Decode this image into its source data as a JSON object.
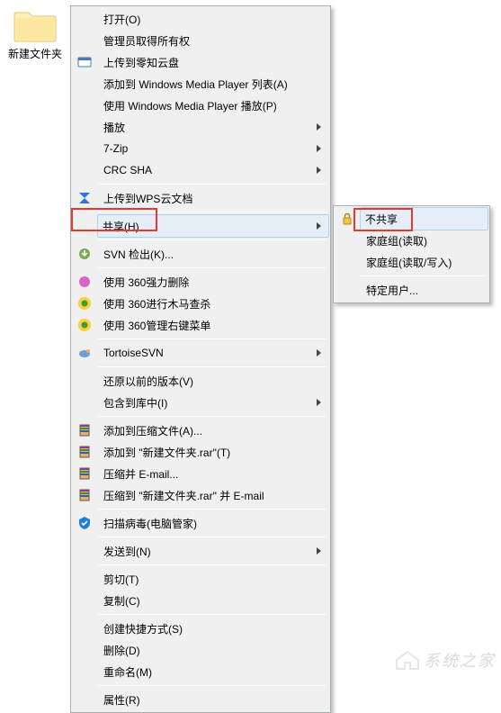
{
  "folder": {
    "label": "新建文件夹"
  },
  "main_menu": {
    "groups": [
      [
        {
          "label": "打开(O)",
          "icon": null,
          "sub": false
        },
        {
          "label": "管理员取得所有权",
          "icon": null,
          "sub": false
        },
        {
          "label": "上传到零知云盘",
          "icon": "cloud",
          "sub": false
        },
        {
          "label": "添加到 Windows Media Player 列表(A)",
          "icon": null,
          "sub": false
        },
        {
          "label": "使用 Windows Media Player 播放(P)",
          "icon": null,
          "sub": false
        },
        {
          "label": "播放",
          "icon": null,
          "sub": true
        },
        {
          "label": "7-Zip",
          "icon": null,
          "sub": true
        },
        {
          "label": "CRC SHA",
          "icon": null,
          "sub": true
        }
      ],
      [
        {
          "label": "上传到WPS云文档",
          "icon": "wps",
          "sub": false
        }
      ],
      [
        {
          "label": "共享(H)",
          "icon": null,
          "sub": true,
          "highlight": true
        }
      ],
      [
        {
          "label": "SVN 检出(K)...",
          "icon": "svn-checkout",
          "sub": false
        }
      ],
      [
        {
          "label": "使用 360强力删除",
          "icon": "360-del",
          "sub": false
        },
        {
          "label": "使用 360进行木马查杀",
          "icon": "360-scan",
          "sub": false
        },
        {
          "label": "使用 360管理右键菜单",
          "icon": "360-menu",
          "sub": false
        }
      ],
      [
        {
          "label": "TortoiseSVN",
          "icon": "tortoise",
          "sub": true
        }
      ],
      [
        {
          "label": "还原以前的版本(V)",
          "icon": null,
          "sub": false
        },
        {
          "label": "包含到库中(I)",
          "icon": null,
          "sub": true
        }
      ],
      [
        {
          "label": "添加到压缩文件(A)...",
          "icon": "rar",
          "sub": false
        },
        {
          "label": "添加到 \"新建文件夹.rar\"(T)",
          "icon": "rar",
          "sub": false
        },
        {
          "label": "压缩并 E-mail...",
          "icon": "rar",
          "sub": false
        },
        {
          "label": "压缩到 \"新建文件夹.rar\" 并 E-mail",
          "icon": "rar",
          "sub": false
        }
      ],
      [
        {
          "label": "扫描病毒(电脑管家)",
          "icon": "guanjia",
          "sub": false
        }
      ],
      [
        {
          "label": "发送到(N)",
          "icon": null,
          "sub": true
        }
      ],
      [
        {
          "label": "剪切(T)",
          "icon": null,
          "sub": false
        },
        {
          "label": "复制(C)",
          "icon": null,
          "sub": false
        }
      ],
      [
        {
          "label": "创建快捷方式(S)",
          "icon": null,
          "sub": false
        },
        {
          "label": "删除(D)",
          "icon": null,
          "sub": false
        },
        {
          "label": "重命名(M)",
          "icon": null,
          "sub": false
        }
      ],
      [
        {
          "label": "属性(R)",
          "icon": null,
          "sub": false
        }
      ]
    ]
  },
  "sub_menu": {
    "groups": [
      [
        {
          "label": "不共享",
          "icon": "lock",
          "sub": false,
          "highlight": true
        },
        {
          "label": "家庭组(读取)",
          "icon": null,
          "sub": false
        },
        {
          "label": "家庭组(读取/写入)",
          "icon": null,
          "sub": false
        }
      ],
      [
        {
          "label": "特定用户...",
          "icon": null,
          "sub": false
        }
      ]
    ]
  },
  "watermark": "系统之家"
}
